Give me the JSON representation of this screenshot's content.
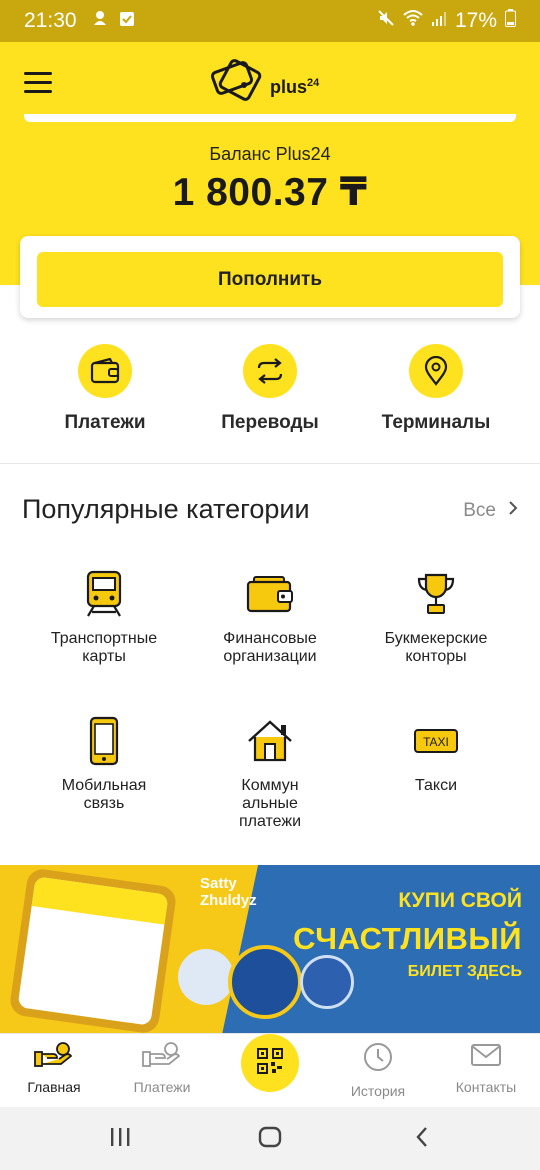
{
  "status_bar": {
    "time": "21:30",
    "battery": "17%",
    "icons": [
      "notification-icon",
      "check-icon",
      "mute-icon",
      "wifi-icon",
      "signal-icon",
      "battery-icon"
    ]
  },
  "header": {
    "logo_text": "plus",
    "logo_sup": "24",
    "balance_label": "Баланс Plus24",
    "balance_value": "1 800.37 ₸",
    "topup_label": "Пополнить"
  },
  "actions": [
    {
      "label": "Платежи",
      "icon": "wallet-icon"
    },
    {
      "label": "Переводы",
      "icon": "transfer-icon"
    },
    {
      "label": "Терминалы",
      "icon": "location-pin-icon"
    }
  ],
  "categories": {
    "title": "Популярные категории",
    "all_label": "Все",
    "items": [
      {
        "label": "Транспортные\nкарты",
        "icon": "train-icon"
      },
      {
        "label": "Финансовые\nорганизации",
        "icon": "wallet-icon"
      },
      {
        "label": "Букмекерские\nконторы",
        "icon": "trophy-icon"
      },
      {
        "label": "Мобильная\nсвязь",
        "icon": "mobile-phone-icon"
      },
      {
        "label": "Коммун\nальные\nплатежи",
        "icon": "house-icon"
      },
      {
        "label": "Такси",
        "icon": "taxi-icon"
      }
    ]
  },
  "banner": {
    "brand_line1": "Satty",
    "brand_line2": "Zhuldyz",
    "line1": "КУПИ СВОЙ",
    "line2": "СЧАСТЛИВЫЙ",
    "line3": "БИЛЕТ ЗДЕСЬ"
  },
  "bottom_nav": [
    {
      "label": "Главная",
      "icon": "hand-coin-icon",
      "active": true
    },
    {
      "label": "Платежи",
      "icon": "hand-coin-icon",
      "active": false
    },
    {
      "label": "",
      "icon": "qr-code-icon",
      "active": false
    },
    {
      "label": "История",
      "icon": "clock-icon",
      "active": false
    },
    {
      "label": "Контакты",
      "icon": "envelope-icon",
      "active": false
    }
  ],
  "colors": {
    "brand_yellow": "#ffe21f",
    "status_bar": "#c8a80e",
    "banner_blue": "#2c6db3"
  }
}
